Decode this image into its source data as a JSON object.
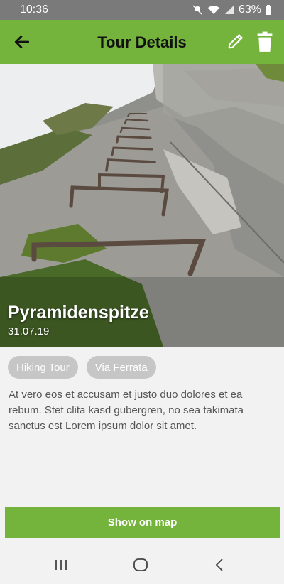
{
  "status_bar": {
    "time": "10:36",
    "battery": "63%",
    "icons": [
      "mute-icon",
      "wifi-icon",
      "signal-icon",
      "battery-icon"
    ]
  },
  "app_bar": {
    "title": "Tour Details",
    "icons": [
      "back-arrow-icon",
      "pencil-icon",
      "trash-icon"
    ],
    "color": "#74b33c"
  },
  "tour": {
    "name": "Pyramidenspitze",
    "date": "31.07.19",
    "tags": [
      "Hiking Tour",
      "Via Ferrata"
    ],
    "description": "At vero eos et accusam et justo duo dolores et ea rebum. Stet clita kasd gubergren, no sea takimata sanctus est Lorem ipsum dolor sit amet."
  },
  "actions": {
    "show_on_map": "Show on map"
  },
  "nav_bar": {
    "icons": [
      "recents-icon",
      "home-icon",
      "back-icon"
    ]
  }
}
